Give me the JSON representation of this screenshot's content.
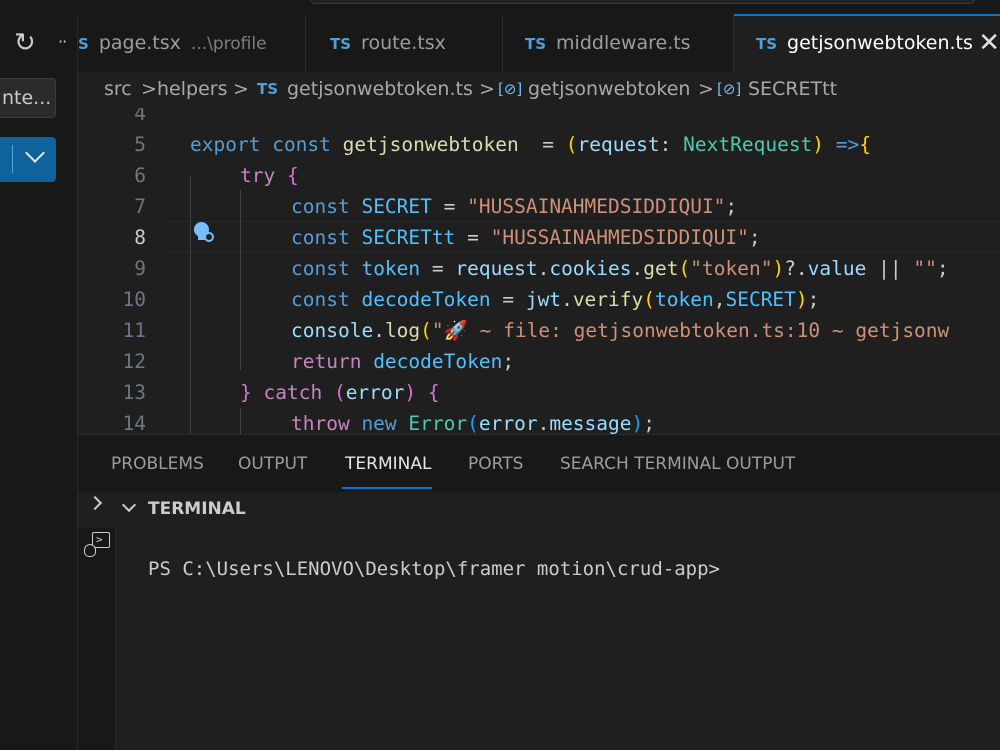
{
  "sidebar": {
    "refresh_icon": "refresh-icon",
    "more": "··",
    "input_text": "nte..."
  },
  "tabs": [
    {
      "badge": "S",
      "label": "page.tsx",
      "desc": "...\\profile"
    },
    {
      "badge": "TS",
      "label": "route.tsx"
    },
    {
      "badge": "TS",
      "label": "middleware.ts"
    },
    {
      "badge": "TS",
      "label": "getjsonwebtoken.ts",
      "close": "✕"
    }
  ],
  "breadcrumb": {
    "items": [
      "src",
      "helpers",
      "getjsonwebtoken.ts",
      "getjsonwebtoken",
      "SECRETtt"
    ],
    "file_badge": "TS",
    "symbol_icon": "[⊘]",
    "sep": ">"
  },
  "editor": {
    "line_numbers": [
      "4",
      "5",
      "6",
      "7",
      "8",
      "9",
      "10",
      "11",
      "12",
      "13",
      "14"
    ],
    "current_line": "8",
    "code": {
      "l5": {
        "export": "export",
        "const": "const",
        "name": "getjsonwebtoken",
        "eq": "  = ",
        "p_open": "(",
        "param": "request",
        "colon": ": ",
        "type": "NextRequest",
        "p_close": ")",
        "arrow": " =>",
        "brace": "{"
      },
      "l6": {
        "try": "try",
        "brace": " {"
      },
      "l7": {
        "const": "const",
        "name": "SECRET",
        "eq": " = ",
        "str": "\"HUSSAINAHMEDSIDDIQUI\"",
        "end": ";"
      },
      "l8": {
        "const": "const",
        "name": "SECRETtt",
        "eq": " = ",
        "str": "\"HUSSAINAHMEDSIDDIQUI\"",
        "end": ";"
      },
      "l9": {
        "const": "const",
        "name": "token",
        "eq": " = ",
        "obj": "request",
        "dot1": ".",
        "prop": "cookies",
        "dot2": ".",
        "fn": "get",
        "po": "(",
        "arg": "\"token\"",
        "pc": ")",
        "chain": "?.",
        "val": "value",
        "or": " || ",
        "empty": "\"\"",
        "end": ";"
      },
      "l10": {
        "const": "const",
        "name": "decodeToken",
        "eq": " = ",
        "obj": "jwt",
        "dot": ".",
        "fn": "verify",
        "po": "(",
        "a1": "token",
        "comma": ",",
        "a2": "SECRET",
        "pc": ")",
        "end": ";"
      },
      "l11": {
        "obj": "console",
        "dot": ".",
        "fn": "log",
        "po": "(",
        "str": "\"🚀 ~ file: getjsonwebtoken.ts:10 ~ getjsonw"
      },
      "l12": {
        "ret": "return",
        "val": " decodeToken",
        "end": ";"
      },
      "l13": {
        "close": "}",
        "catch": " catch",
        "po": " (",
        "err": "error",
        "pc": ")",
        "brace": " {"
      },
      "l14": {
        "throw": "throw",
        "new": " new",
        "cls": " Error",
        "po": "(",
        "obj": "error",
        "dot": ".",
        "prop": "message",
        "pc": ")",
        "end": ";"
      }
    }
  },
  "panel": {
    "tabs": [
      "PROBLEMS",
      "OUTPUT",
      "TERMINAL",
      "PORTS",
      "SEARCH TERMINAL OUTPUT"
    ],
    "active_tab": "TERMINAL",
    "terminal_title": "TERMINAL",
    "prompt": "PS C:\\Users\\LENOVO\\Desktop\\framer motion\\crud-app>"
  },
  "colors": {
    "accent": "#0078d4",
    "keyword": "#569cd6",
    "string": "#ce9178",
    "function": "#dcdcaa",
    "type": "#4ec9b0"
  }
}
